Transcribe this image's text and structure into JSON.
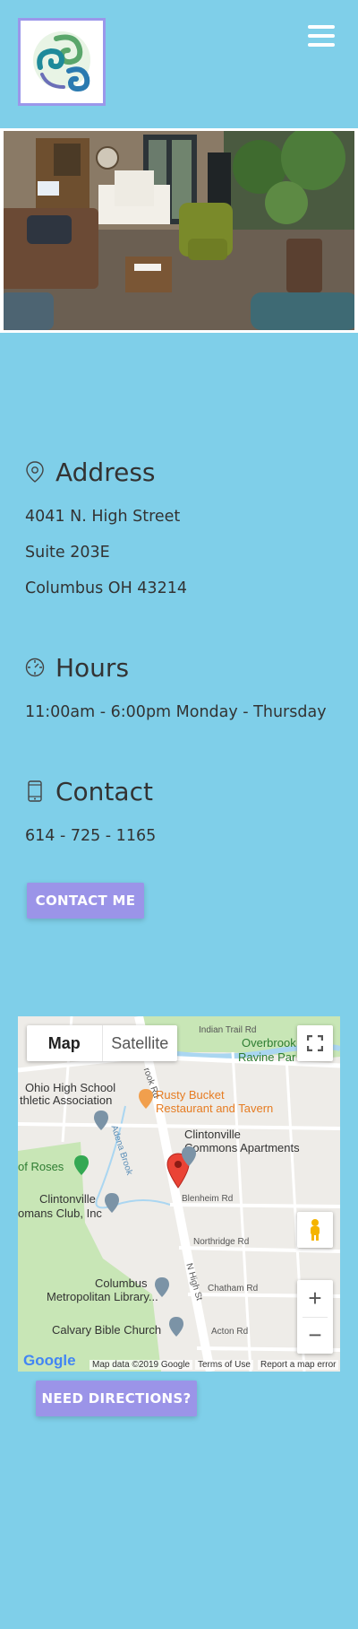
{
  "header": {
    "menu_icon": "hamburger-icon"
  },
  "address": {
    "title": "Address",
    "lines": [
      "4041 N. High Street",
      "Suite 203E",
      "Columbus OH 43214"
    ]
  },
  "hours": {
    "title": "Hours",
    "lines": [
      "11:00am - 6:00pm Monday - Thursday"
    ]
  },
  "contact": {
    "title": "Contact",
    "phone": "614 - 725 - 1165",
    "button_label": "CONTACT ME"
  },
  "map": {
    "tab_map": "Map",
    "tab_satellite": "Satellite",
    "labels": {
      "indian_trail": "Indian Trail Rd",
      "overbrook": "Overbrook",
      "ravine_park": "Ravine Par",
      "ohio_hs": "Ohio High School",
      "athletic": "thletic Association",
      "rusty1": "Rusty Bucket",
      "rusty2": "Restaurant and Tavern",
      "clintonville1": "Clintonville",
      "clintonville2": "Commons Apartments",
      "roses": "of Roses",
      "adena": "Adena Brook",
      "blenheim": "Blenheim Rd",
      "cwc1": "Clintonville",
      "cwc2": "omans Club, Inc",
      "northridge": "Northridge Rd",
      "nhigh": "N High St",
      "chatham": "Chatham Rd",
      "library1": "Columbus",
      "library2": "Metropolitan Library...",
      "calvary": "Calvary Bible Church",
      "acton": "Acton Rd",
      "brook_rd": "rook Rd"
    },
    "google": "Google",
    "attribution": "Map data ©2019 Google",
    "terms": "Terms of Use",
    "report": "Report a map error"
  },
  "directions_label": "NEED DIRECTIONS?"
}
